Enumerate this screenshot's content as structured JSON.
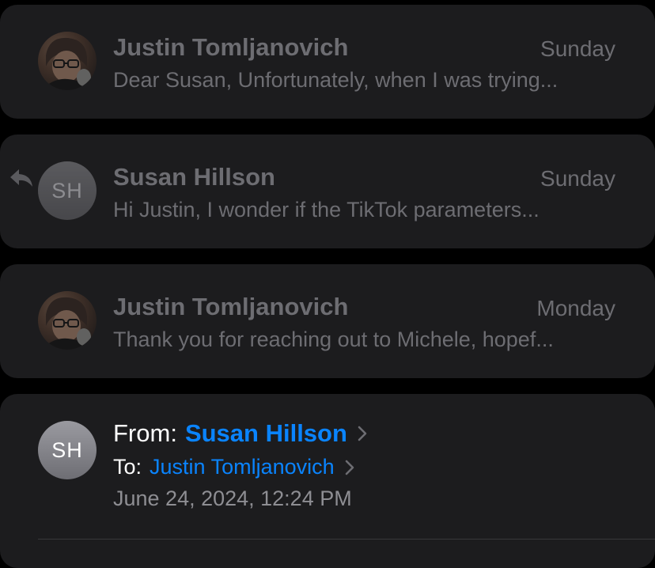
{
  "thread": [
    {
      "sender": "Justin Tomljanovich",
      "date": "Sunday",
      "preview": "Dear Susan, Unfortunately, when I was trying...",
      "avatar_type": "photo",
      "replied": false
    },
    {
      "sender": "Susan Hillson",
      "date": "Sunday",
      "preview": "Hi Justin, I wonder if the TikTok parameters...",
      "avatar_initials": "SH",
      "replied": true
    },
    {
      "sender": "Justin Tomljanovich",
      "date": "Monday",
      "preview": "Thank you for reaching out to Michele, hopef...",
      "avatar_type": "photo",
      "replied": false
    }
  ],
  "open_message": {
    "avatar_initials": "SH",
    "from_label": "From:",
    "from_name": "Susan Hillson",
    "to_label": "To:",
    "to_name": "Justin Tomljanovich",
    "datetime": "June 24, 2024, 12:24 PM"
  },
  "colors": {
    "background": "#000000",
    "card": "#1c1c1e",
    "dim_text": "#6d6d72",
    "link": "#0a84ff",
    "primary_text": "#ffffff"
  }
}
